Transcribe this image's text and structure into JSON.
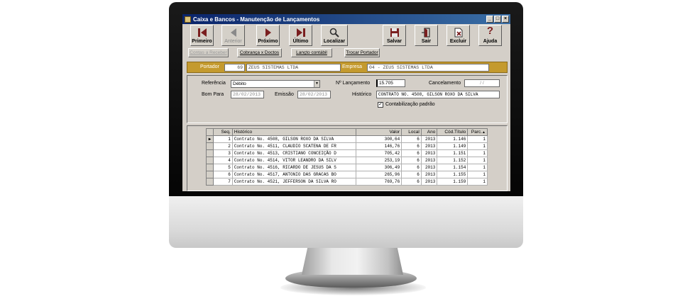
{
  "window": {
    "title": "Caixa e Bancos - Manutenção de Lançamentos",
    "controls": [
      "_",
      "□",
      "×"
    ]
  },
  "toolbar": {
    "first": "Primeiro",
    "previous": "Anterior",
    "next": "Próximo",
    "last": "Último",
    "find": "Localizar",
    "save": "Salvar",
    "exit": "Sair",
    "delete": "Excluir",
    "help": "Ajuda",
    "help_glyph": "?"
  },
  "links": {
    "contas_receber": "Contas a Receber",
    "cobranca": "Cobrança x Doctos",
    "lancto_contabil": "Lançto contábil",
    "trocar_portador": "Trocar Portador"
  },
  "portador": {
    "label": "Portador",
    "code": "69",
    "name": "ZEUS SISTEMAS LTDA",
    "empresa_label": "Empresa",
    "empresa_value": "04 - ZEUS SISTEMAS LTDA"
  },
  "form": {
    "referencia_label": "Referência",
    "referencia_value": "Débito",
    "lancamento_label": "Nº Lançamento",
    "lancamento_value": "15.705",
    "cancelamento_label": "Cancelamento",
    "cancelamento_value": "/   /",
    "bom_para_label": "Bom Para",
    "bom_para_value": "28/02/2013",
    "emissao_label": "Emissão",
    "emissao_value": "28/02/2013",
    "historico_label": "Histórico",
    "historico_value": "CONTRATO NO. 4508, GILSON ROXO DA SILVA",
    "contabilizacao_label": "Contabilização padrão",
    "contabilizacao_checked": "✓"
  },
  "grid": {
    "columns": [
      "Seq.",
      "Histórico",
      "Valor",
      "Local",
      "Ano",
      "Cód.Título",
      "Parc."
    ],
    "sort_glyph": "▲",
    "current_row_glyph": "▶",
    "rows": [
      {
        "seq": "1",
        "historico": "Contrato No. 4508, GILSON ROXO DA SILVA",
        "valor": "300,64",
        "local": "6",
        "ano": "2013",
        "cod": "1.146",
        "parc": "1"
      },
      {
        "seq": "2",
        "historico": "Contrato No. 4511, CLAUDIO SCATENA DE FR",
        "valor": "146,76",
        "local": "6",
        "ano": "2013",
        "cod": "1.149",
        "parc": "1"
      },
      {
        "seq": "3",
        "historico": "Contrato No. 4513, CRISTIANO CONCEIÇÃO D",
        "valor": "705,42",
        "local": "6",
        "ano": "2013",
        "cod": "1.151",
        "parc": "1"
      },
      {
        "seq": "4",
        "historico": "Contrato No. 4514, VITOR LEANDRO DA SILV",
        "valor": "253,19",
        "local": "6",
        "ano": "2013",
        "cod": "1.152",
        "parc": "1"
      },
      {
        "seq": "5",
        "historico": "Contrato No. 4516, RICARDO DE JESUS DA S",
        "valor": "306,49",
        "local": "6",
        "ano": "2013",
        "cod": "1.154",
        "parc": "1"
      },
      {
        "seq": "6",
        "historico": "Contrato No. 4517, ANTONIO DAS GRACAS BO",
        "valor": "265,96",
        "local": "6",
        "ano": "2013",
        "cod": "1.155",
        "parc": "1"
      },
      {
        "seq": "7",
        "historico": "Contrato No. 4521, JEFFERSON DA SILVA RO",
        "valor": "769,76",
        "local": "6",
        "ano": "2013",
        "cod": "1.159",
        "parc": "1"
      }
    ]
  },
  "colors": {
    "titlebar": "#0a246a",
    "window_bg": "#d4cfc8",
    "portador_bar": "#c49a2e",
    "icon_maroon": "#7a1f1f"
  }
}
